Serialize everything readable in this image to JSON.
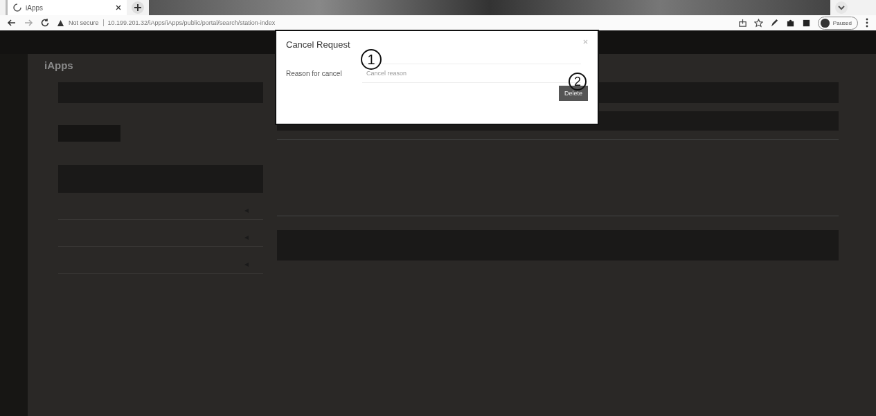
{
  "browser": {
    "tab_title": "iApps",
    "security_label": "Not secure",
    "url": "10.199.201.32/iApps/iApps/public/portal/search/station-index",
    "profile_label": "Paused"
  },
  "page": {
    "heading": "iApps"
  },
  "modal": {
    "title": "Cancel Request",
    "field_label": "Reason for cancel",
    "placeholder": "Cancel reason",
    "button": "Delete"
  },
  "annotations": [
    "1",
    "2"
  ]
}
